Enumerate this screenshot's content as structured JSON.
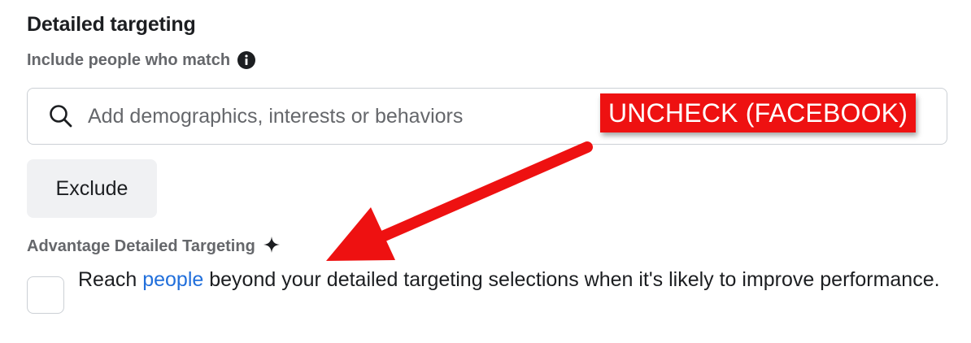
{
  "section": {
    "title": "Detailed targeting",
    "include_label": "Include people who match"
  },
  "search": {
    "placeholder": "Add demographics, interests or behaviors"
  },
  "exclude": {
    "label": "Exclude"
  },
  "advantage": {
    "label": "Advantage Detailed Targeting",
    "checkbox_checked": false,
    "text_before": "Reach ",
    "link_text": "people",
    "text_after": " beyond your detailed targeting selections when it's likely to improve performance."
  },
  "annotation": {
    "label": "UNCHECK (FACEBOOK)"
  },
  "icons": {
    "info": "info-icon",
    "search": "search-icon",
    "sparkle": "sparkle-icon",
    "arrow": "arrow-annotation"
  },
  "colors": {
    "text_primary": "#1c1e21",
    "text_secondary": "#65676b",
    "link": "#216fdb",
    "annotation_red": "#ee1111",
    "button_bg": "#f0f1f3",
    "border": "#ccd0d5"
  }
}
